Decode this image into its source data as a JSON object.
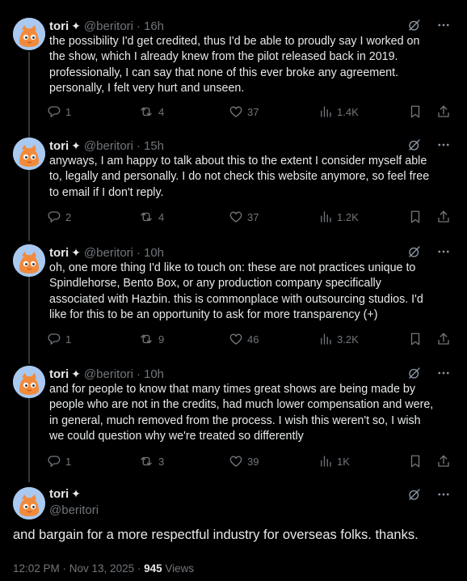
{
  "author": {
    "name": "tori",
    "verified_glyph": "✦",
    "handle": "@beritori"
  },
  "tweets": [
    {
      "time": "16h",
      "text": "the possibility I'd get credited, thus I'd be able to proudly say I worked on the show, which I already knew from the pilot released back in 2019. professionally, I can say that none of this ever broke any agreement. personally, I felt very hurt and unseen.",
      "replies": "1",
      "reposts": "4",
      "likes": "37",
      "views": "1.4K"
    },
    {
      "time": "15h",
      "text": "anyways, I am happy to talk about this to the extent I consider myself able to, legally and personally. I do not check this website anymore, so feel free to email if I don't reply.",
      "replies": "2",
      "reposts": "4",
      "likes": "37",
      "views": "1.2K"
    },
    {
      "time": "10h",
      "text": "oh, one more thing I'd like to touch on: these are not practices unique to Spindlehorse, Bento Box, or any production company specifically associated with Hazbin. this is commonplace with outsourcing studios. I'd like for this to be an opportunity to ask for more transparency (+)",
      "replies": "1",
      "reposts": "9",
      "likes": "46",
      "views": "3.2K"
    },
    {
      "time": "10h",
      "text": "and for people to know that many times great shows are being made by people who are not in the credits, had much lower compensation and were, in general, much removed from the process. I wish this weren't so, I wish we could question why we're treated so differently",
      "replies": "1",
      "reposts": "3",
      "likes": "39",
      "views": "1K"
    }
  ],
  "main_tweet": {
    "text": "and bargain for a more respectful industry for overseas folks. thanks.",
    "timestamp": "12:02 PM · Nov 13, 2025 · ",
    "views_count": "945",
    "views_label": " Views"
  },
  "icons": {
    "reply": "reply-icon",
    "repost": "repost-icon",
    "like": "like-icon",
    "views": "views-icon",
    "bookmark": "bookmark-icon",
    "share": "share-icon",
    "grok": "grok-icon",
    "more": "more-icon"
  }
}
